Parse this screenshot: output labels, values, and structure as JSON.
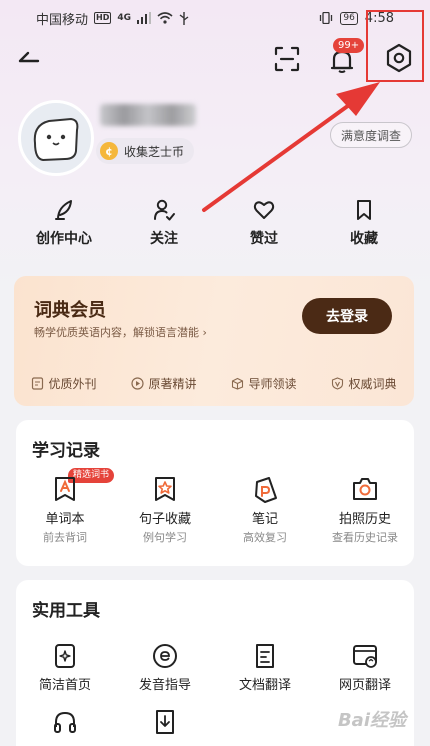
{
  "status_bar": {
    "carrier": "中国移动",
    "hd": "HD",
    "signal": "4G",
    "battery": "96",
    "time": "4:58"
  },
  "nav": {
    "notification_count": "99+"
  },
  "profile": {
    "coin_label": "收集芝士币",
    "survey_label": "满意度调查"
  },
  "quick_actions": [
    {
      "label": "创作中心",
      "icon": "feather-icon"
    },
    {
      "label": "关注",
      "icon": "person-check-icon"
    },
    {
      "label": "赞过",
      "icon": "heart-icon"
    },
    {
      "label": "收藏",
      "icon": "bookmark-icon"
    }
  ],
  "member": {
    "title": "词典会员",
    "subtitle": "畅学优质英语内容，解锁语言潜能",
    "login_label": "去登录",
    "features": [
      "优质外刊",
      "原著精讲",
      "导师领读",
      "权威词典"
    ]
  },
  "study": {
    "title": "学习记录",
    "badge": "精选词书",
    "items": [
      {
        "label": "单词本",
        "sub": "前去背词"
      },
      {
        "label": "句子收藏",
        "sub": "例句学习"
      },
      {
        "label": "笔记",
        "sub": "高效复习"
      },
      {
        "label": "拍照历史",
        "sub": "查看历史记录"
      }
    ]
  },
  "tools": {
    "title": "实用工具",
    "items": [
      {
        "label": "简洁首页"
      },
      {
        "label": "发音指导"
      },
      {
        "label": "文档翻译"
      },
      {
        "label": "网页翻译"
      }
    ]
  },
  "watermark": "Bai经验",
  "colors": {
    "accent_red": "#e5433a",
    "member_dark": "#4b2a15",
    "member_bg": "#fbe3cf"
  }
}
